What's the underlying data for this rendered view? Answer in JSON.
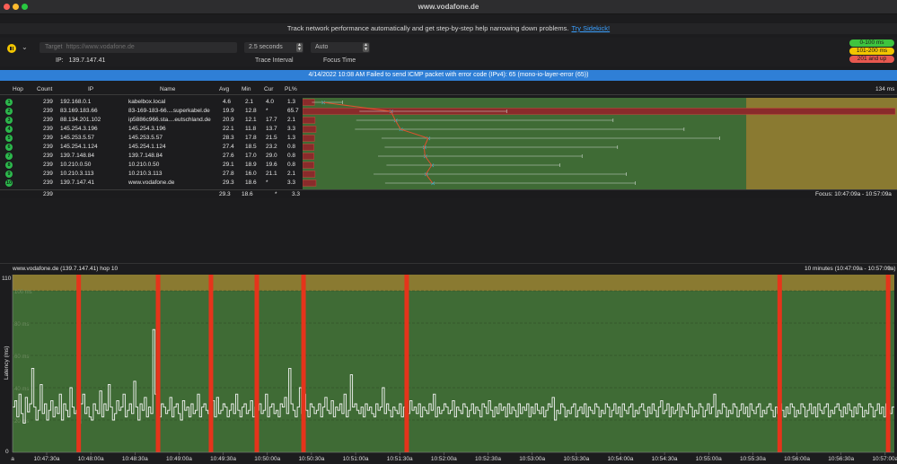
{
  "window": {
    "title": "www.vodafone.de"
  },
  "banner": {
    "text": "Track network performance automatically and get step-by-step help narrowing down problems.",
    "link": "Try Sidekick!"
  },
  "toolbar": {
    "target_label": "Target",
    "target_placeholder": "https://www.vodafone.de",
    "ip_label": "IP:",
    "ip_value": "139.7.147.41",
    "trace_interval_value": "2.5 seconds",
    "trace_interval_label": "Trace Interval",
    "focus_time_value": "Auto",
    "focus_time_label": "Focus Time"
  },
  "latency_legend": [
    {
      "label": "0-100 ms",
      "color": "#3ec43e"
    },
    {
      "label": "101-200 ms",
      "color": "#f2c500"
    },
    {
      "label": "201 and up",
      "color": "#e8584f"
    }
  ],
  "error_message": "4/14/2022 10:08 AM Failed to send ICMP packet with error code (IPv4): 65 (mono-io-layer-error (65))",
  "table": {
    "columns": [
      "Hop",
      "Count",
      "IP",
      "Name",
      "Avg",
      "Min",
      "Cur",
      "PL%"
    ],
    "max_label": "134 ms",
    "rows": [
      {
        "hop": "1",
        "count": "239",
        "ip": "192.168.0.1",
        "name": "kabelbox.local",
        "avg": "4.6",
        "min": "2.1",
        "cur": "4.0",
        "pl": "1.3"
      },
      {
        "hop": "2",
        "count": "239",
        "ip": "83.169.183.66",
        "name": "83-169-183-66....superkabel.de",
        "avg": "19.9",
        "min": "12.8",
        "cur": "*",
        "pl": "65.7"
      },
      {
        "hop": "3",
        "count": "239",
        "ip": "88.134.201.102",
        "name": "ip5886c966.sta....eutschland.de",
        "avg": "20.9",
        "min": "12.1",
        "cur": "17.7",
        "pl": "2.1"
      },
      {
        "hop": "4",
        "count": "239",
        "ip": "145.254.3.196",
        "name": "145.254.3.196",
        "avg": "22.1",
        "min": "11.8",
        "cur": "13.7",
        "pl": "3.3"
      },
      {
        "hop": "5",
        "count": "239",
        "ip": "145.253.5.57",
        "name": "145.253.5.57",
        "avg": "28.3",
        "min": "17.8",
        "cur": "21.5",
        "pl": "1.3"
      },
      {
        "hop": "6",
        "count": "239",
        "ip": "145.254.1.124",
        "name": "145.254.1.124",
        "avg": "27.4",
        "min": "18.5",
        "cur": "23.2",
        "pl": "0.8"
      },
      {
        "hop": "7",
        "count": "239",
        "ip": "139.7.148.84",
        "name": "139.7.148.84",
        "avg": "27.6",
        "min": "17.0",
        "cur": "29.0",
        "pl": "0.8"
      },
      {
        "hop": "8",
        "count": "239",
        "ip": "10.210.0.50",
        "name": "10.210.0.50",
        "avg": "29.1",
        "min": "18.9",
        "cur": "19.6",
        "pl": "0.8"
      },
      {
        "hop": "9",
        "count": "239",
        "ip": "10.210.3.113",
        "name": "10.210.3.113",
        "avg": "27.8",
        "min": "16.0",
        "cur": "21.1",
        "pl": "2.1"
      },
      {
        "hop": "10",
        "count": "239",
        "ip": "139.7.147.41",
        "name": "www.vodafone.de",
        "avg": "29.3",
        "min": "18.6",
        "cur": "*",
        "pl": "3.3"
      }
    ],
    "route_stats": [
      {
        "avg": 4.6,
        "min": 2.1,
        "max": 9,
        "pl": 1.3
      },
      {
        "avg": 19.9,
        "min": 12.8,
        "max": 46,
        "pl": 65.7
      },
      {
        "avg": 20.9,
        "min": 12.1,
        "max": 70,
        "pl": 2.1
      },
      {
        "avg": 22.1,
        "min": 11.8,
        "max": 86,
        "pl": 3.3
      },
      {
        "avg": 28.3,
        "min": 17.8,
        "max": 94,
        "pl": 1.3
      },
      {
        "avg": 27.4,
        "min": 18.5,
        "max": 71,
        "pl": 0.8
      },
      {
        "avg": 27.6,
        "min": 17.0,
        "max": 63,
        "pl": 0.8
      },
      {
        "avg": 29.1,
        "min": 18.9,
        "max": 58,
        "pl": 0.8
      },
      {
        "avg": 27.8,
        "min": 16.0,
        "max": 73,
        "pl": 2.1
      },
      {
        "avg": 29.3,
        "min": 18.6,
        "max": 75,
        "pl": 3.3
      }
    ],
    "totals": {
      "count": "239",
      "avg": "29.3",
      "min": "18.6",
      "cur": "*",
      "pl": "3.3"
    },
    "focus_label": "Focus: 10:47:09a - 10:57:09a"
  },
  "timeline": {
    "title": "www.vodafone.de (139.7.147.41) hop 10",
    "range_label": "10 minutes (10:47:09a - 10:57:09a)"
  },
  "chart_data": {
    "type": "line",
    "title": "www.vodafone.de (139.7.147.41) hop 10",
    "ylabel": "Latency (ms)",
    "xlabel": "",
    "ylim": [
      0,
      110
    ],
    "y_ticks": [
      "110",
      "0"
    ],
    "grid_labels": [
      "100 ms",
      "80 ms",
      "60 ms",
      "40 ms",
      "20 ms"
    ],
    "x_ticks": [
      "a",
      "10:47:30a",
      "10:48:00a",
      "10:48:30a",
      "10:49:00a",
      "10:49:30a",
      "10:50:00a",
      "10:50:30a",
      "10:51:00a",
      "10:51:30a",
      "10:52:00a",
      "10:52:30a",
      "10:53:00a",
      "10:53:30a",
      "10:54:00a",
      "10:54:30a",
      "10:55:00a",
      "10:55:30a",
      "10:56:00a",
      "10:56:30a",
      "10:57:00a"
    ],
    "zones": [
      {
        "label": "0-100 ms",
        "from": 0,
        "to": 100,
        "color": "#3f6b35"
      },
      {
        "label": "101-200 ms",
        "from": 100,
        "to": 110,
        "color": "#8a7a31"
      }
    ],
    "packet_loss_markers": [
      0.075,
      0.165,
      0.225,
      0.277,
      0.33,
      0.447,
      0.87,
      0.993
    ],
    "series": [
      {
        "values": [
          28,
          32,
          22,
          36,
          24,
          18,
          34,
          25,
          30,
          52,
          28,
          20,
          26,
          42,
          24,
          30,
          20,
          26,
          32,
          22,
          28,
          24,
          36,
          20,
          30,
          26,
          22,
          40,
          28,
          24,
          26,
          18,
          30,
          36,
          24,
          28,
          22,
          20,
          30,
          26,
          24,
          38,
          22,
          30,
          26,
          42,
          28,
          20,
          24,
          32,
          26,
          28,
          36,
          22,
          26,
          30,
          24,
          44,
          28,
          20,
          30,
          26,
          34,
          22,
          28,
          24,
          76,
          36,
          26,
          22,
          30,
          28,
          24,
          26,
          34,
          22,
          28,
          30,
          24,
          20,
          32,
          26,
          28,
          22,
          30,
          24,
          26,
          36,
          22,
          28,
          30,
          26,
          24,
          28,
          32,
          22,
          34,
          24,
          26,
          30,
          28,
          22,
          26,
          30,
          24,
          36,
          26,
          22,
          28,
          30,
          24,
          26,
          32,
          22,
          28,
          26,
          30,
          24,
          26,
          36,
          22,
          28,
          30,
          24,
          26,
          22,
          30,
          28,
          34,
          24,
          52,
          30,
          26,
          22,
          28,
          40,
          24,
          36,
          26,
          22,
          30,
          28,
          24,
          26,
          30,
          22,
          28,
          34,
          26,
          24,
          32,
          22,
          28,
          26,
          30,
          24,
          36,
          22,
          26,
          48,
          28,
          30,
          26,
          24,
          28,
          22,
          30,
          26,
          28,
          24,
          22,
          30,
          26,
          28,
          40,
          24,
          30,
          26,
          22,
          28,
          26,
          24,
          30,
          22,
          28,
          26,
          24,
          32,
          26,
          28,
          24,
          30,
          22,
          28,
          26,
          24,
          30,
          26,
          36,
          22,
          28,
          24,
          26,
          30,
          28,
          24,
          26,
          32,
          22,
          28,
          26,
          24,
          30,
          28,
          22,
          26,
          30,
          24,
          28,
          26,
          22,
          30,
          28,
          24,
          32,
          26,
          22,
          28,
          24,
          30,
          26,
          28,
          22,
          30,
          24,
          28,
          26,
          22,
          30,
          24,
          28,
          26,
          30,
          22,
          28,
          24,
          30,
          26,
          24,
          28,
          22,
          26,
          30,
          28,
          34,
          20,
          26,
          24,
          30,
          28,
          22,
          26,
          24,
          28,
          30,
          22,
          26,
          28,
          24,
          30,
          22,
          28,
          26,
          24,
          30,
          28,
          22,
          26,
          24,
          30,
          28,
          22,
          26,
          30,
          24,
          28,
          22,
          30,
          26,
          24,
          28,
          30,
          22,
          26,
          24,
          28,
          30,
          26,
          22,
          28,
          24,
          30,
          26,
          22,
          28,
          32,
          24,
          26,
          30,
          22,
          28,
          24,
          26,
          30,
          22,
          28,
          26,
          24,
          30,
          28,
          22,
          26,
          24,
          30,
          28,
          22,
          26,
          30,
          24,
          28,
          36,
          22,
          26,
          24,
          30,
          28,
          22,
          26,
          24,
          30,
          28,
          22,
          26,
          30,
          24,
          28,
          22,
          30,
          26,
          24,
          28,
          30,
          22,
          26,
          24,
          28,
          30,
          26,
          22,
          28,
          24,
          30,
          26,
          22,
          28,
          24,
          30,
          28,
          22,
          26,
          24,
          30,
          28,
          22,
          26,
          30,
          24,
          28,
          22,
          30,
          26,
          24,
          28,
          30,
          22,
          26,
          24,
          28,
          30,
          26,
          22,
          28,
          24,
          30,
          26,
          22,
          28,
          24,
          30,
          28,
          22,
          26,
          24,
          30,
          28,
          22,
          26,
          30,
          24,
          28,
          22,
          30,
          26,
          24,
          28
        ]
      }
    ]
  }
}
